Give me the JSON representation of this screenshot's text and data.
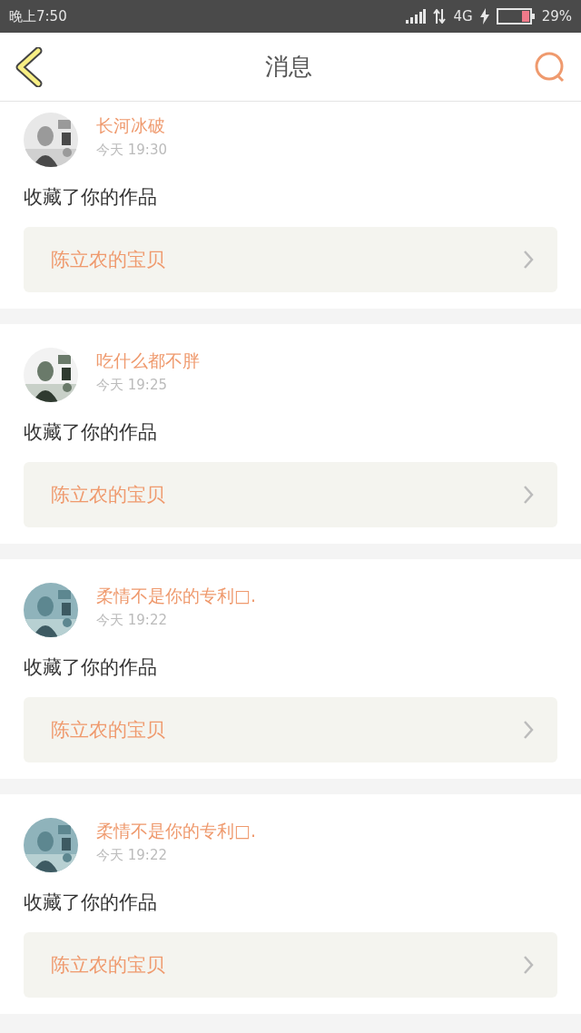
{
  "status_bar": {
    "time": "晚上7:50",
    "network": "4G",
    "battery": "29%"
  },
  "header": {
    "title": "消息"
  },
  "messages": [
    {
      "name": "长河冰破",
      "time": "今天 19:30",
      "action": "收藏了你的作品",
      "item": "陈立农的宝贝"
    },
    {
      "name": "吃什么都不胖",
      "time": "今天 19:25",
      "action": "收藏了你的作品",
      "item": "陈立农的宝贝"
    },
    {
      "name": "柔情不是你的专利□.",
      "time": "今天 19:22",
      "action": "收藏了你的作品",
      "item": "陈立农的宝贝"
    },
    {
      "name": "柔情不是你的专利□.",
      "time": "今天 19:22",
      "action": "收藏了你的作品",
      "item": "陈立农的宝贝"
    }
  ]
}
